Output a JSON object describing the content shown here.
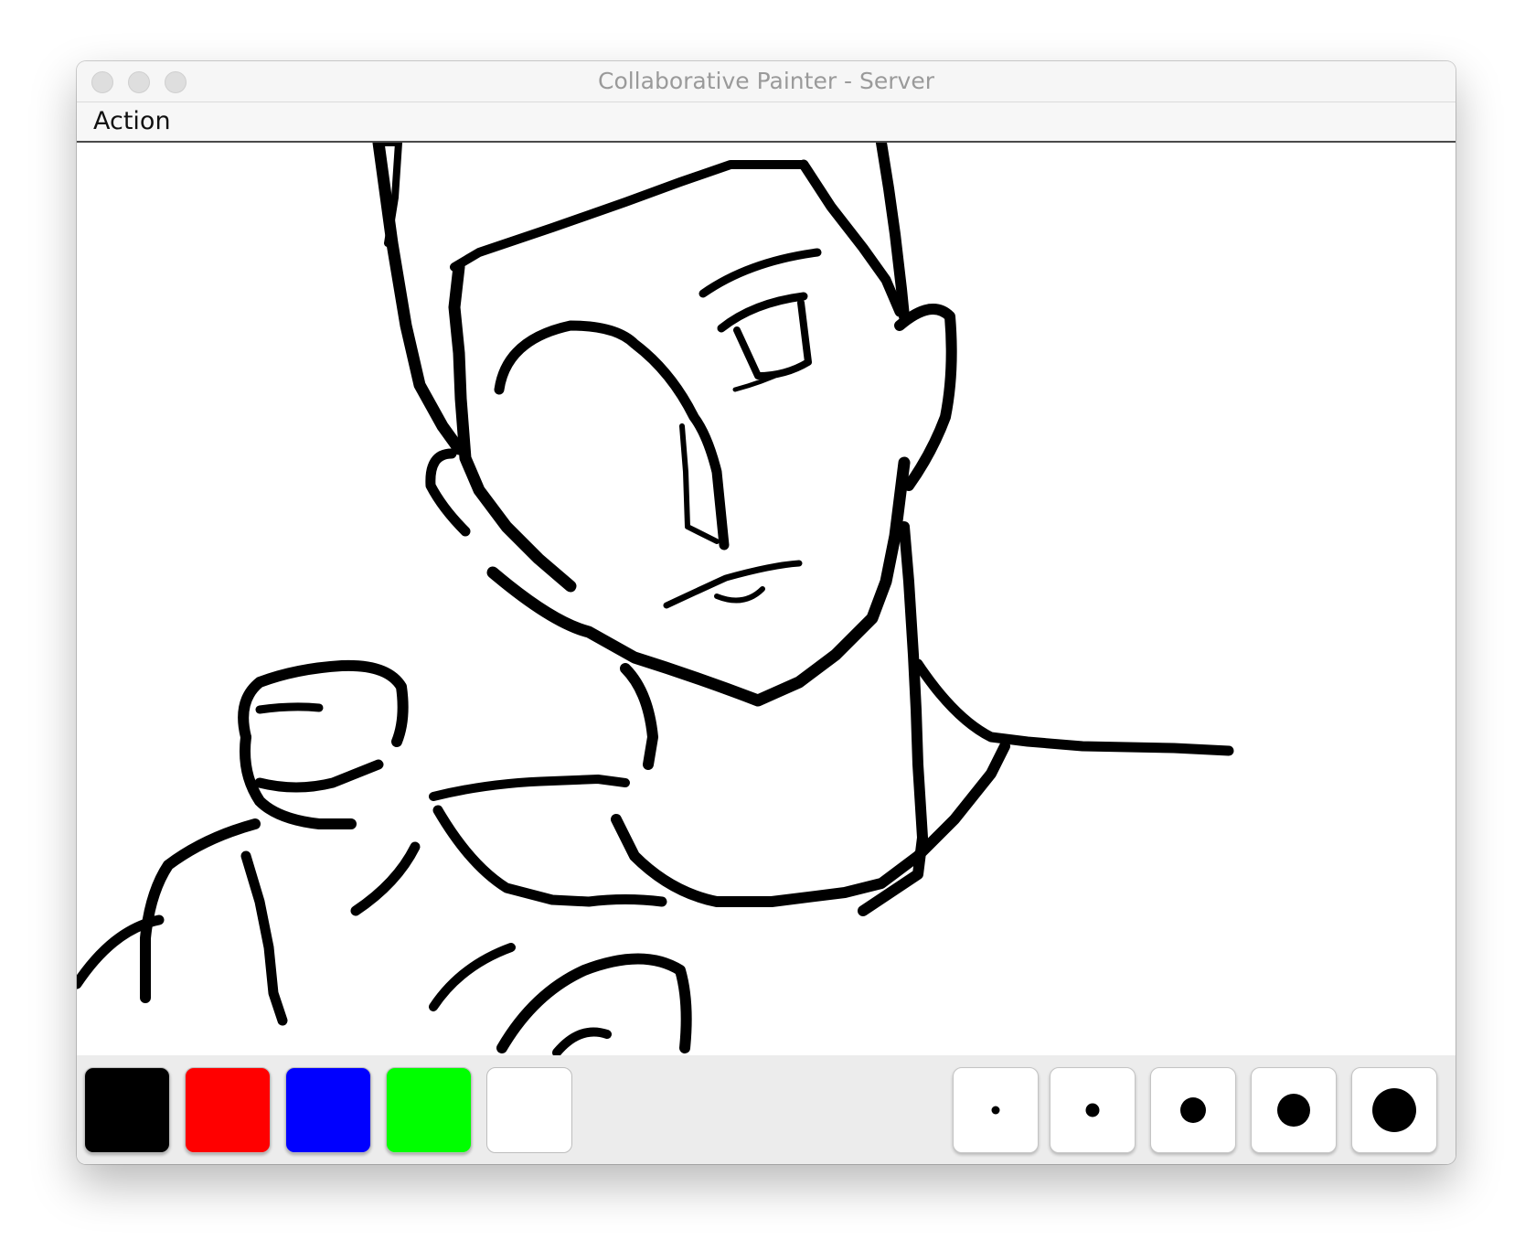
{
  "window": {
    "title": "Collaborative Painter - Server"
  },
  "menubar": {
    "items": [
      {
        "label": "Action"
      }
    ]
  },
  "palette": {
    "colors": [
      {
        "name": "black",
        "hex": "#000000"
      },
      {
        "name": "red",
        "hex": "#ff0000"
      },
      {
        "name": "blue",
        "hex": "#0000ff"
      },
      {
        "name": "green",
        "hex": "#00ff00"
      },
      {
        "name": "white",
        "hex": "#ffffff"
      }
    ]
  },
  "brush_sizes": [
    "extra-small",
    "small",
    "medium",
    "large",
    "extra-large"
  ],
  "canvas": {
    "stroke_color": "#000000",
    "background": "#ffffff",
    "content": "black line drawing sketch of a character"
  }
}
